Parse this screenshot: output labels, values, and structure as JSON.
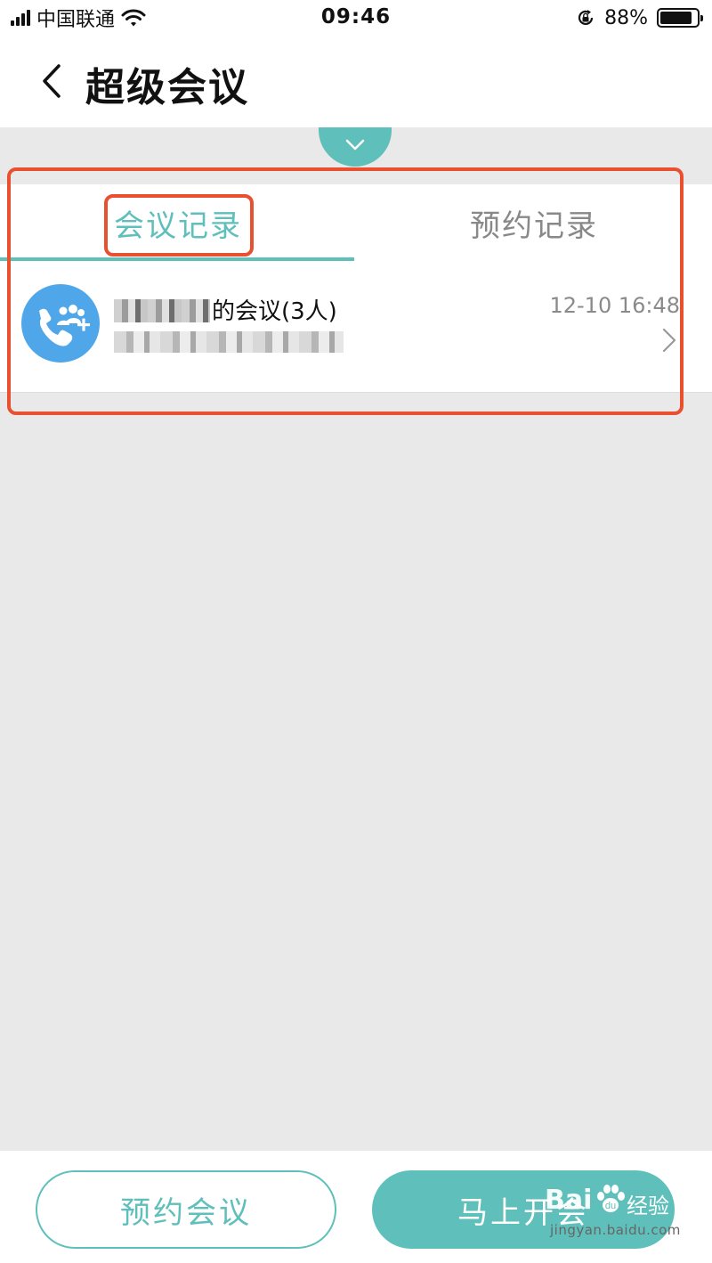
{
  "status_bar": {
    "carrier": "中国联通",
    "time": "09:46",
    "battery_percent": "88%",
    "battery_level": 0.88,
    "icons": [
      "signal-icon",
      "wifi-icon",
      "orientation-lock-icon",
      "battery-icon"
    ]
  },
  "nav": {
    "back_icon": "chevron-left-icon",
    "title": "超级会议"
  },
  "collapse_toggle": {
    "icon": "chevron-down-icon"
  },
  "tabs": [
    {
      "label": "会议记录",
      "active": true
    },
    {
      "label": "预约记录",
      "active": false
    }
  ],
  "records": [
    {
      "title_visible": "的会议(3人)",
      "time": "12-10 16:48",
      "icon": "conference-call-icon"
    }
  ],
  "bottom": {
    "reserve_label": "预约会议",
    "start_label": "马上开会"
  },
  "watermark": {
    "logo": "Bai",
    "text": "经验",
    "url": "jingyan.baidu.com"
  },
  "colors": {
    "accent": "#5fbfba",
    "avatar": "#4fa6e8",
    "highlight": "#e8502f",
    "background": "#e9e9e9"
  }
}
